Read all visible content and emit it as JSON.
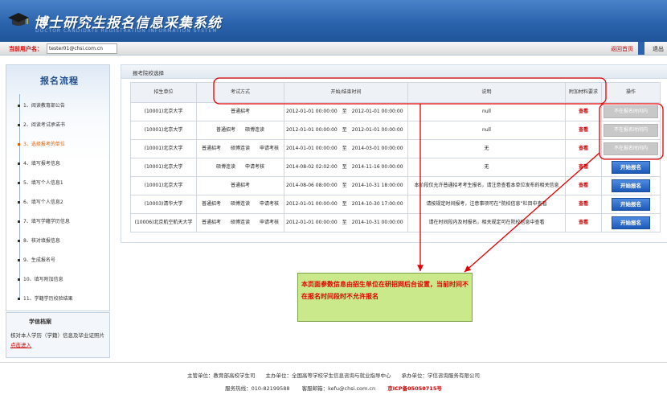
{
  "header": {
    "title": "博士研究生报名信息采集系统",
    "subtitle_en": "DOCTOR CANDIDATE REGISTRATION INFORMATION SYSTEM",
    "cap_icon": "graduation-cap-icon"
  },
  "userbar": {
    "label": "当前用户名：",
    "username": "tester01@chsi.com.cn",
    "back": "返回首页",
    "logout": "退出"
  },
  "sidebar": {
    "title": "报名流程",
    "steps": [
      "1、阅读教育部公告",
      "2、阅读考试承诺书",
      "3、选择报考的单位",
      "4、填写报考信息",
      "5、填写个人信息1",
      "6、填写个人信息2",
      "7、填写学籍学历信息",
      "8、核对填报信息",
      "9、生成报名号",
      "10、填写附加信息",
      "11、学籍学历校验结果"
    ],
    "active_index": 2
  },
  "xuexin": {
    "title": "学信档案",
    "text": "核对本人学历（学籍）信息及毕业证照片",
    "link": "点击进入"
  },
  "main": {
    "section_title": "报考院校选择",
    "columns": [
      "招生单位",
      "考试方式",
      "开始/结束时间",
      "至",
      "说明",
      "附加材料要求",
      "操作"
    ],
    "rows": [
      {
        "unit": "(10001)北京大学",
        "mode": "普通招考",
        "start": "2012-01-01 00:00:00",
        "end": "2012-01-01 00:00:00",
        "note": "null",
        "extra": "查看",
        "action": "不在报名时间内",
        "enabled": false
      },
      {
        "unit": "(10001)北京大学",
        "mode": "普通招考　　硕博连读",
        "start": "2012-01-01 00:00:00",
        "end": "2012-01-01 00:00:00",
        "note": "null",
        "extra": "查看",
        "action": "不在报名时间内",
        "enabled": false
      },
      {
        "unit": "(10001)北京大学",
        "mode": "普通招考　　硕博连读　　申请考核",
        "start": "2014-01-01 00:00:00",
        "end": "2014-03-01 00:00:00",
        "note": "无",
        "extra": "查看",
        "action": "不在报名时间内",
        "enabled": false
      },
      {
        "unit": "(10001)北京大学",
        "mode": "硕博连读　　申请考核",
        "start": "2014-08-02 02:02:00",
        "end": "2014-11-16 00:00:00",
        "note": "无",
        "extra": "查看",
        "action": "开始报名",
        "enabled": true
      },
      {
        "unit": "(10001)北京大学",
        "mode": "普通招考",
        "start": "2014-08-06 08:00:00",
        "end": "2014-10-31 18:00:00",
        "note": "本阶段仅允许普通招考考生报名，请注意查看本单位发布的相关信息",
        "extra": "查看",
        "action": "开始报名",
        "enabled": true
      },
      {
        "unit": "(10003)清华大学",
        "mode": "普通招考　　硕博连读　　申请考核",
        "start": "2012-01-01 00:00:00",
        "end": "2014-10-30 17:00:00",
        "note": "请按规定时间报考，注意事项可在“院校信息”栏目中查看",
        "extra": "查看",
        "action": "开始报名",
        "enabled": true
      },
      {
        "unit": "(10006)北京航空航天大学",
        "mode": "普通招考　　硕博连读　　申请考核",
        "start": "2012-01-01 00:00:00",
        "end": "2014-10-31 00:00:00",
        "note": "请在时间段内及时报名，相关规定可在院校信息中查看",
        "extra": "查看",
        "action": "开始报名",
        "enabled": true
      }
    ]
  },
  "annotation": {
    "text": "本页面参数信息由招生单位在研招网后台设置，当前时间不在报名时间段时不允许报名",
    "highlight_color": "#e00000"
  },
  "footer": {
    "line1": "主管单位：教育部高校学生司　　主办单位：全国高等学校学生信息咨询与就业指导中心　　承办单位：学信咨询服务有限公司",
    "hotline": "服务热线：010-82199588",
    "email": "客服邮箱：kefu@chsi.com.cn",
    "icp": "京ICP备05050715号"
  }
}
